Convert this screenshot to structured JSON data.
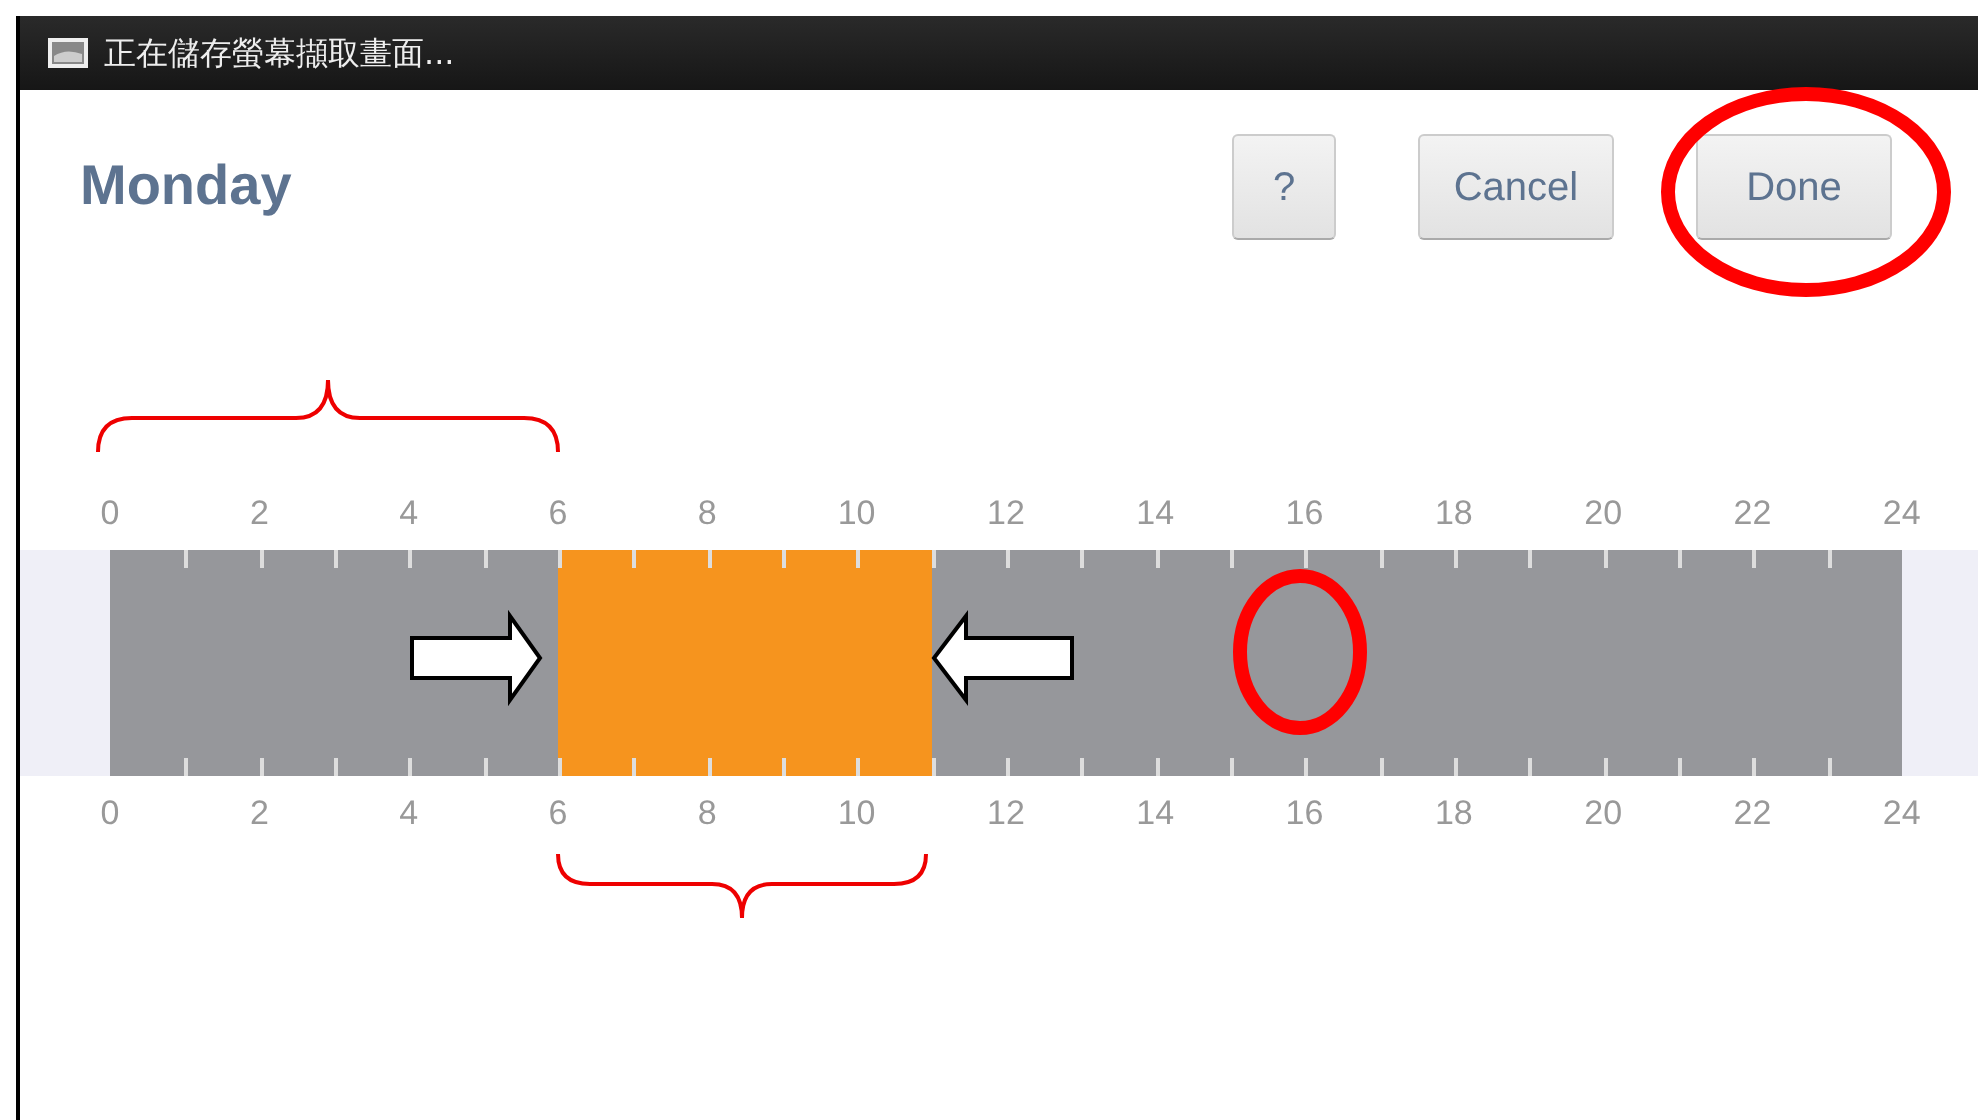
{
  "status_bar": {
    "text": "正在儲存螢幕擷取畫面..."
  },
  "title": "Monday",
  "buttons": [
    {
      "label": "?",
      "kind": "help"
    },
    {
      "label": "Cancel",
      "kind": "cancel"
    },
    {
      "label": "Done",
      "kind": "done"
    }
  ],
  "top_labels": [
    "0",
    "2",
    "4",
    "6",
    "8",
    "10",
    "12",
    "14",
    "16",
    "18",
    "20",
    "22",
    "24"
  ],
  "bottom_labels": [
    "0",
    "2",
    "4",
    "6",
    "8",
    "10",
    "12",
    "14",
    "16",
    "18",
    "20",
    "22",
    "24"
  ],
  "hours": [
    {
      "selected": false
    },
    {
      "selected": false
    },
    {
      "selected": false
    },
    {
      "selected": false
    },
    {
      "selected": false
    },
    {
      "selected": false
    },
    {
      "selected": true
    },
    {
      "selected": true
    },
    {
      "selected": true
    },
    {
      "selected": true
    },
    {
      "selected": true
    },
    {
      "selected": false
    },
    {
      "selected": false
    },
    {
      "selected": false
    },
    {
      "selected": false
    },
    {
      "selected": false
    },
    {
      "selected": false
    },
    {
      "selected": false
    },
    {
      "selected": false
    },
    {
      "selected": false
    },
    {
      "selected": false
    },
    {
      "selected": false
    },
    {
      "selected": false
    },
    {
      "selected": false
    }
  ]
}
